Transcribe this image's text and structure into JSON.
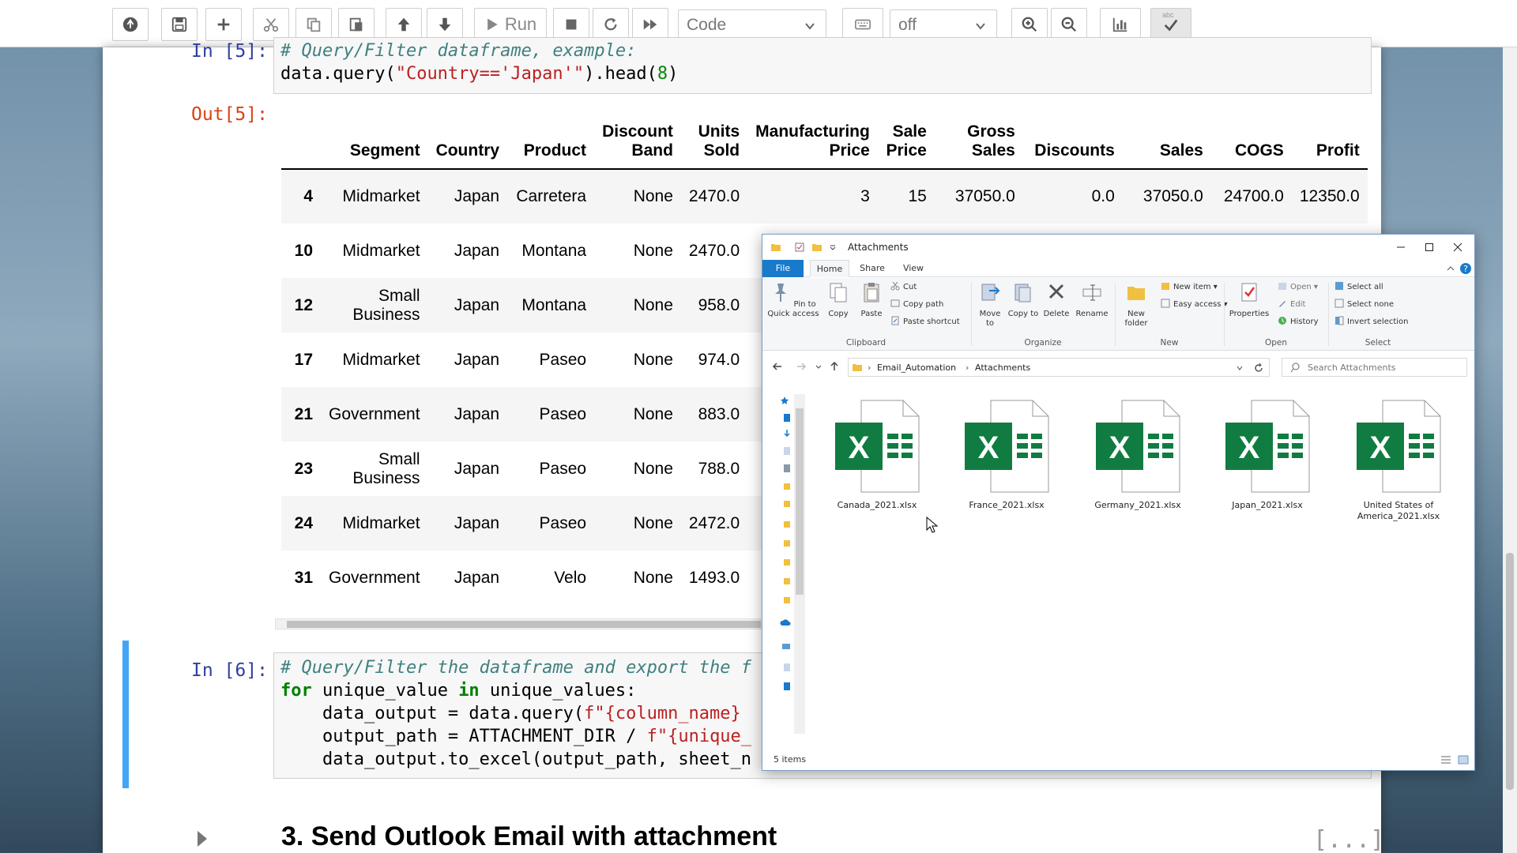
{
  "toolbar": {
    "run_label": "Run",
    "cell_type": "Code",
    "keymap_value": "off",
    "spell_label": "abc"
  },
  "notebook": {
    "cell5": {
      "prompt_in": "In [5]:",
      "prompt_out": "Out[5]:",
      "code": [
        "# Query/Filter dataframe, example:",
        "data.query(\"Country=='Japan'\").head(8)"
      ]
    },
    "output_table": {
      "columns": [
        [
          "",
          ""
        ],
        [
          "Segment",
          ""
        ],
        [
          "Country",
          ""
        ],
        [
          "Product",
          ""
        ],
        [
          "Discount",
          "Band"
        ],
        [
          "Units",
          "Sold"
        ],
        [
          "Manufacturing",
          "Price"
        ],
        [
          "Sale",
          "Price"
        ],
        [
          "Gross",
          "Sales"
        ],
        [
          "Discounts",
          ""
        ],
        [
          "Sales",
          ""
        ],
        [
          "COGS",
          ""
        ],
        [
          "Profit",
          ""
        ]
      ],
      "rows": [
        [
          "4",
          "Midmarket",
          "Japan",
          "Carretera",
          "None",
          "2470.0",
          "3",
          "15",
          "37050.0",
          "0.0",
          "37050.0",
          "24700.0",
          "12350.0"
        ],
        [
          "10",
          "Midmarket",
          "Japan",
          "Montana",
          "None",
          "2470.0",
          "",
          "",
          "",
          "",
          "",
          "",
          ""
        ],
        [
          "12",
          "Small Business",
          "Japan",
          "Montana",
          "None",
          "958.0",
          "",
          "",
          "",
          "",
          "",
          "",
          ""
        ],
        [
          "17",
          "Midmarket",
          "Japan",
          "Paseo",
          "None",
          "974.0",
          "",
          "",
          "",
          "",
          "",
          "",
          ""
        ],
        [
          "21",
          "Government",
          "Japan",
          "Paseo",
          "None",
          "883.0",
          "",
          "",
          "",
          "",
          "",
          "",
          ""
        ],
        [
          "23",
          "Small Business",
          "Japan",
          "Paseo",
          "None",
          "788.0",
          "",
          "",
          "",
          "",
          "",
          "",
          ""
        ],
        [
          "24",
          "Midmarket",
          "Japan",
          "Paseo",
          "None",
          "2472.0",
          "",
          "",
          "",
          "",
          "",
          "",
          ""
        ],
        [
          "31",
          "Government",
          "Japan",
          "Velo",
          "None",
          "1493.0",
          "",
          "",
          "",
          "",
          "",
          "",
          ""
        ]
      ]
    },
    "cell6": {
      "prompt_in": "In [6]:",
      "code": [
        "# Query/Filter the dataframe and export the f",
        "for unique_value in unique_values:",
        "    data_output = data.query(f\"{column_name} ",
        "    output_path = ATTACHMENT_DIR / f\"{unique_",
        "    data_output.to_excel(output_path, sheet_n"
      ]
    },
    "heading": "3. Send Outlook Email with attachment",
    "heading_collapsed": "[...]"
  },
  "explorer": {
    "title": "Attachments",
    "tabs": [
      "File",
      "Home",
      "Share",
      "View"
    ],
    "ribbon": {
      "clipboard": {
        "label": "Clipboard",
        "pin": "Pin to Quick access",
        "copy": "Copy",
        "paste": "Paste",
        "cut": "Cut",
        "copy_path": "Copy path",
        "paste_shortcut": "Paste shortcut"
      },
      "organize": {
        "label": "Organize",
        "move_to": "Move to",
        "copy_to": "Copy to",
        "delete": "Delete",
        "rename": "Rename"
      },
      "new": {
        "label": "New",
        "new_folder": "New folder",
        "new_item": "New item",
        "easy_access": "Easy access"
      },
      "open": {
        "label": "Open",
        "properties": "Properties",
        "open": "Open",
        "edit": "Edit",
        "history": "History"
      },
      "select": {
        "label": "Select",
        "select_all": "Select all",
        "select_none": "Select none",
        "invert_selection": "Invert selection"
      }
    },
    "path": [
      "Email_Automation",
      "Attachments"
    ],
    "search_placeholder": "Search Attachments",
    "files": [
      "Canada_2021.xlsx",
      "France_2021.xlsx",
      "Germany_2021.xlsx",
      "Japan_2021.xlsx",
      "United States of America_2021.xlsx"
    ],
    "status": "5 items"
  },
  "colors": {
    "excel_green": "#107c41",
    "prompt_in": "#303f9f",
    "prompt_out": "#d84315",
    "selected_cell_bar": "#42a5f5",
    "file_tab": "#1979ca"
  }
}
